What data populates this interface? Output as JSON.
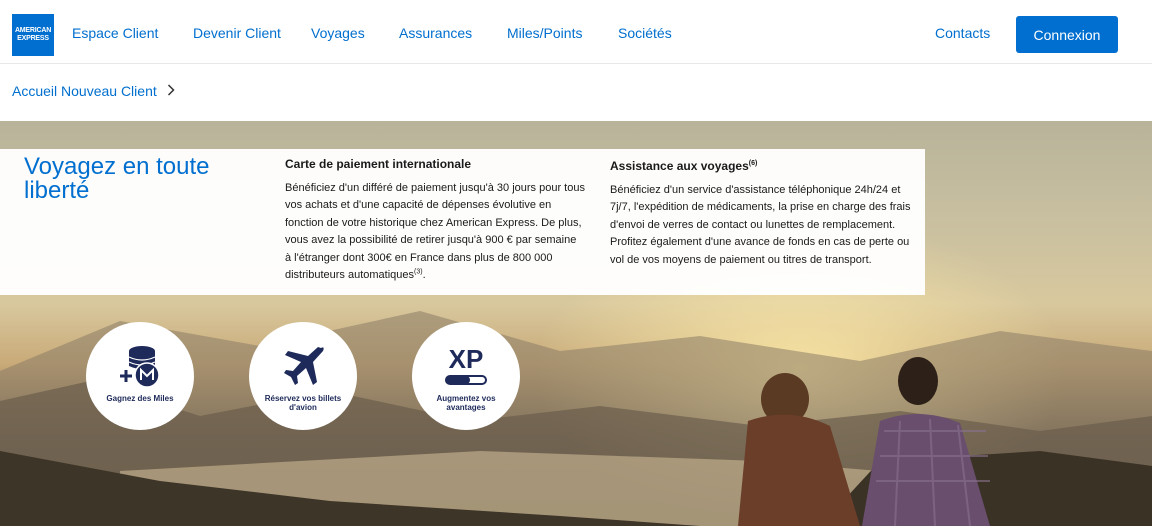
{
  "brand": {
    "logo_line1": "AMERICAN",
    "logo_line2": "EXPRESS",
    "color": "#016fd0"
  },
  "nav": {
    "items": [
      {
        "label": "Espace Client"
      },
      {
        "label": "Devenir Client"
      },
      {
        "label": "Voyages"
      },
      {
        "label": "Assurances"
      },
      {
        "label": "Miles/Points"
      },
      {
        "label": "Sociétés"
      }
    ],
    "contacts": "Contacts",
    "login": "Connexion"
  },
  "breadcrumb": {
    "label": "Accueil Nouveau Client",
    "icon": "chevron-right-icon"
  },
  "hero": {
    "title": "Voyagez en toute liberté",
    "col1": {
      "heading": "Carte de paiement internationale",
      "body": "Bénéficiez d'un différé de paiement jusqu'à 30 jours pour tous vos achats et d'une capacité de dépenses évolutive en fonction de votre historique chez American Express. De plus, vous avez la possibilité de retirer jusqu'à 900 € par semaine à l'étranger dont 300€ en France dans plus de 800 000 distributeurs automatiques",
      "sup": "(3)",
      "tail": "."
    },
    "col2": {
      "heading": "Assistance aux voyages",
      "heading_sup": "(6)",
      "body": "Bénéficiez d'un service d'assistance téléphonique 24h/24 et 7j/7, l'expédition de médicaments, la prise en charge des frais d'envoi de verres de contact ou lunettes de remplacement. Profitez également d'une avance de fonds en cas de perte ou vol de vos moyens de paiement ou titres de transport."
    },
    "features": [
      {
        "label": "Gagnez des Miles",
        "icon": "miles-icon"
      },
      {
        "label": "Réservez vos billets d'avion",
        "icon": "airplane-icon"
      },
      {
        "label": "Augmentez vos avantages",
        "icon": "xp-icon",
        "icon_text": "XP"
      }
    ]
  }
}
